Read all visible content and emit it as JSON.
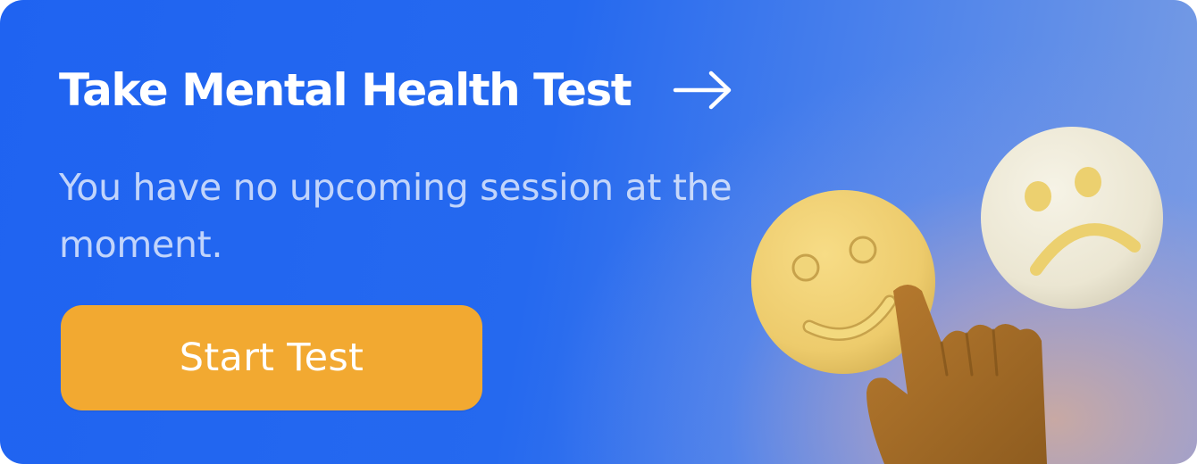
{
  "banner": {
    "title": "Take Mental Health Test",
    "subtitle": "You have no upcoming session at the moment.",
    "cta_label": "Start Test"
  },
  "icons": {
    "title_arrow": "arrow-right-icon",
    "illustration": [
      "happy-face-token",
      "sad-face-token",
      "pointing-hand"
    ]
  },
  "colors": {
    "background_start": "#1f63f1",
    "background_end": "#7b9ee3",
    "button": "#f2a931",
    "text": "#ffffff"
  }
}
